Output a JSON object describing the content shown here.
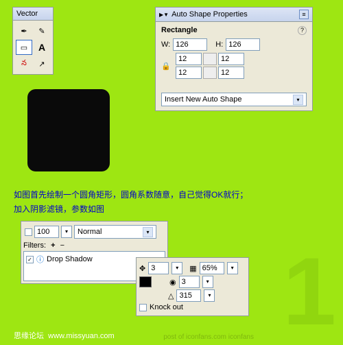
{
  "vector": {
    "title": "Vector",
    "tools": [
      "pen-a",
      "pen-b",
      "rect",
      "text",
      "redpen",
      "arrow"
    ]
  },
  "props": {
    "title": "Auto Shape Properties",
    "subtitle": "Rectangle",
    "w_label": "W:",
    "w_val": "126",
    "h_label": "H:",
    "h_val": "126",
    "c1": "12",
    "c2": "12",
    "c3": "12",
    "c4": "12",
    "dropdown": "Insert New Auto Shape"
  },
  "instructions": {
    "line1": "如图首先绘制一个圆角矩形，圆角系数随意，自己觉得OK就行；",
    "line2": "加入阴影滤镜，参数如图"
  },
  "filters": {
    "opacity": "100",
    "blend": "Normal",
    "label": "Filters:",
    "item": "Drop Shadow"
  },
  "settings": {
    "dist": "3",
    "opacity": "65%",
    "soft": "3",
    "angle": "315",
    "knock": "Knock out"
  },
  "footer": {
    "site": "思缘论坛",
    "url": "www.missyuan.com",
    "wm": "post of iconfans.com  iconfans"
  }
}
